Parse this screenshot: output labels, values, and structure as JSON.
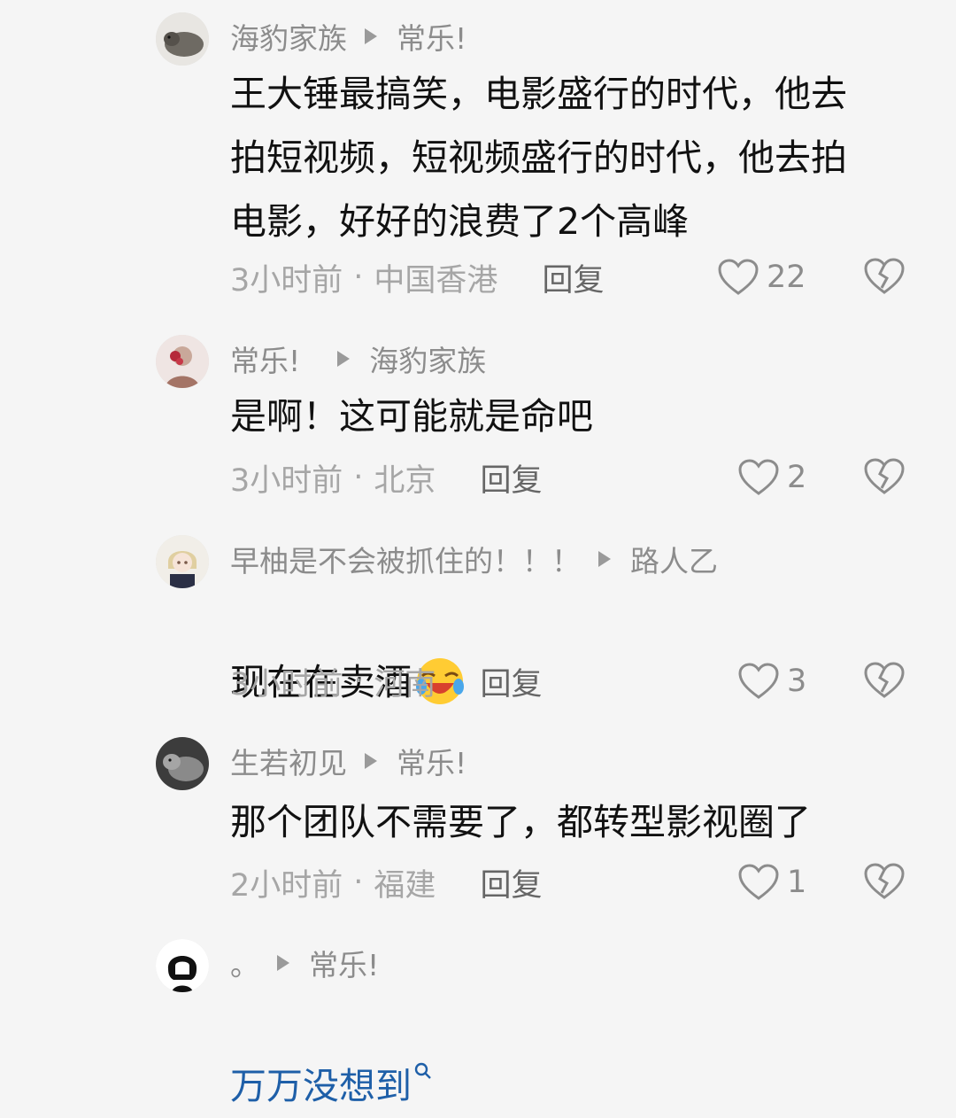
{
  "comments": [
    {
      "author": "海豹家族",
      "reply_to": "常乐!",
      "text": "王大锤最搞笑，电影盛行的时代，他去\n拍短视频，短视频盛行的时代，他去拍\n电影，好好的浪费了2个高峰",
      "time": "3小时前",
      "location": "中国香港",
      "reply_label": "回复",
      "likes": "22"
    },
    {
      "author": "常乐!",
      "reply_to": "海豹家族",
      "text": "是啊！这可能就是命吧",
      "time": "3小时前",
      "location": "北京",
      "reply_label": "回复",
      "likes": "2"
    },
    {
      "author": "早柚是不会被抓住的！！！",
      "reply_to": "路人乙",
      "text": "现在在卖酒",
      "time": "3小时前",
      "location": "河南",
      "reply_label": "回复",
      "likes": "3"
    },
    {
      "author": "生若初见",
      "reply_to": "常乐!",
      "text": "那个团队不需要了，都转型影视圈了",
      "time": "2小时前",
      "location": "福建",
      "reply_label": "回复",
      "likes": "1"
    },
    {
      "author": "。",
      "reply_to": "常乐!",
      "link_text": "万万没想到"
    }
  ],
  "icons": {
    "separator": "play-triangle-icon",
    "like": "heart-outline-icon",
    "dislike": "broken-heart-icon",
    "emoji": "laughing-tears-emoji",
    "search": "search-icon"
  },
  "colors": {
    "background": "#f5f5f5",
    "text": "#111111",
    "meta": "#a6a6a6",
    "link": "#1e5fa8"
  }
}
